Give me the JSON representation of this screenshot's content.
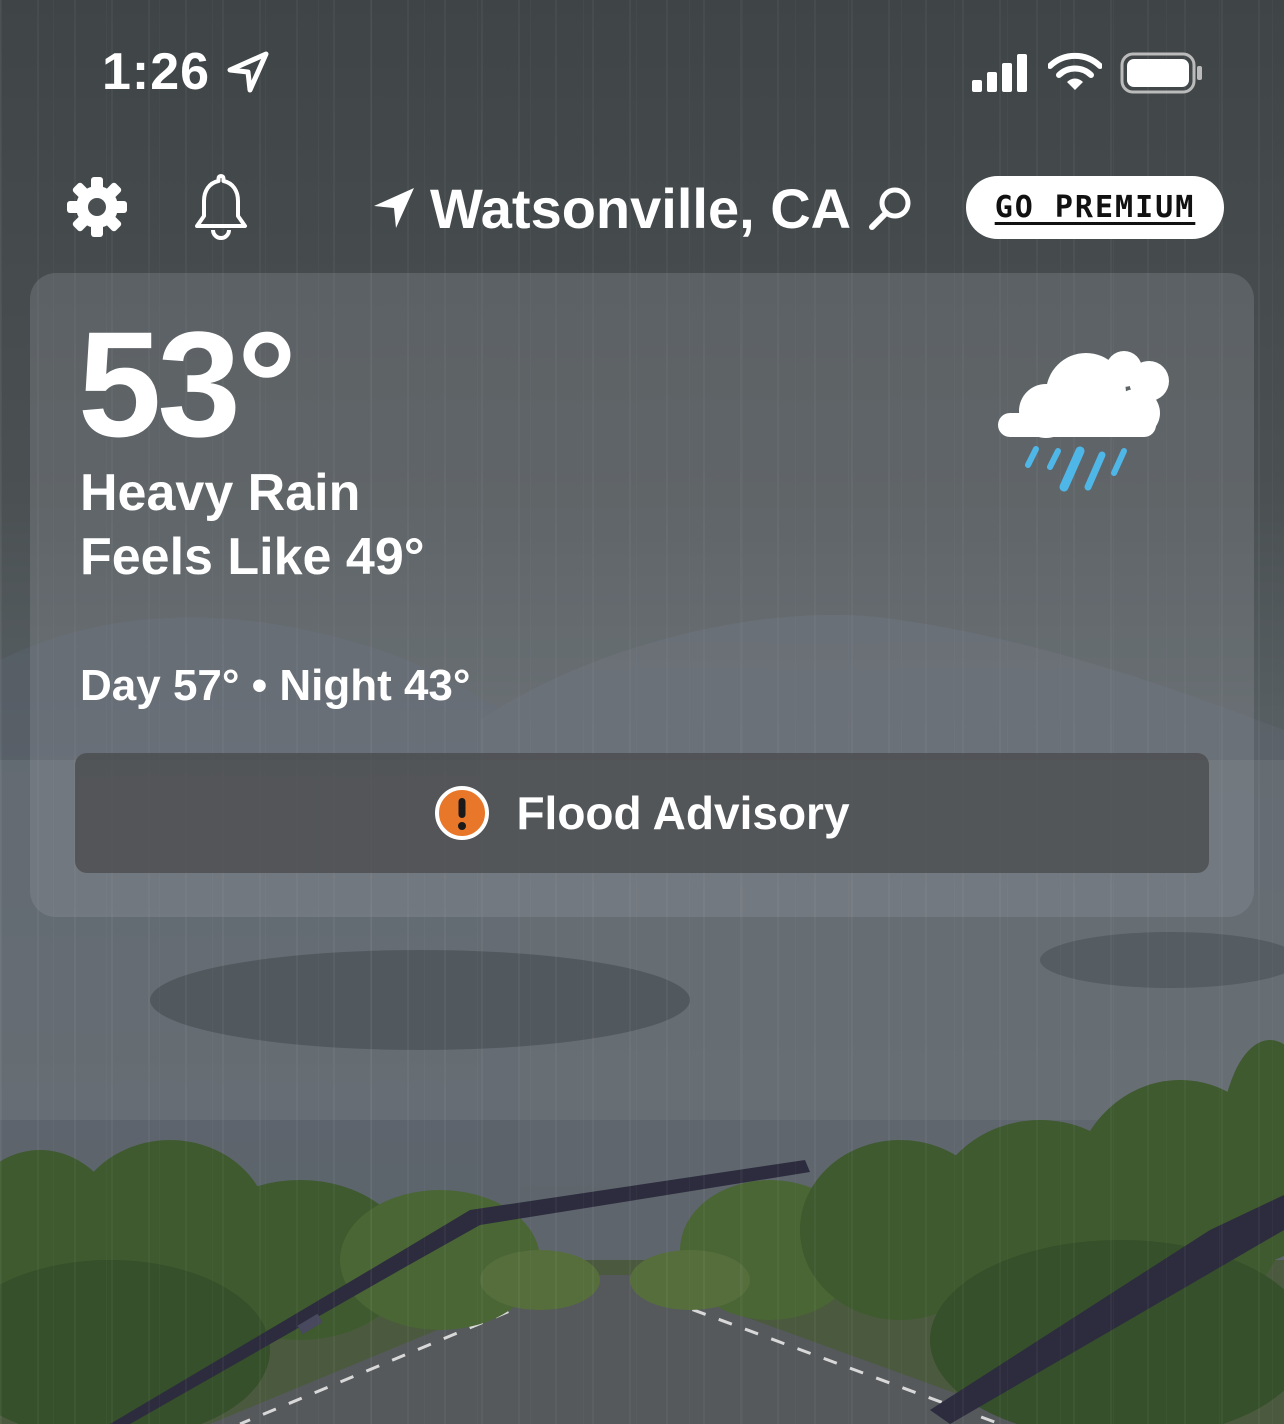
{
  "status_bar": {
    "time": "1:26"
  },
  "header": {
    "location": "Watsonville, CA",
    "premium_label": "GO PREMIUM"
  },
  "current": {
    "temperature": "53°",
    "condition": "Heavy Rain",
    "feels_like": "Feels Like 49°",
    "day_night": "Day 57° • Night 43°"
  },
  "alert": {
    "label": "Flood Advisory",
    "icon": "exclamation-circle-icon",
    "color": "#e8772a"
  },
  "colors": {
    "rain_drop": "#4fb7e8",
    "cloud": "#ffffff",
    "premium_bg": "#ffffff"
  }
}
